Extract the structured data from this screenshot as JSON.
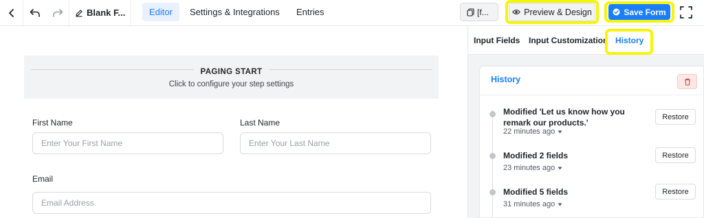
{
  "header": {
    "form_title": "Blank F...",
    "tabs": [
      {
        "label": "Editor",
        "active": true
      },
      {
        "label": "Settings & Integrations",
        "active": false
      },
      {
        "label": "Entries",
        "active": false
      }
    ],
    "shortcode_label": "[f...",
    "preview_label": "Preview & Design",
    "save_label": "Save Form"
  },
  "editor": {
    "paging_title": "PAGING START",
    "paging_subtitle": "Click to configure your step settings",
    "fields": {
      "first_name": {
        "label": "First Name",
        "placeholder": "Enter Your First Name"
      },
      "last_name": {
        "label": "Last Name",
        "placeholder": "Enter Your Last Name"
      },
      "email": {
        "label": "Email",
        "placeholder": "Email Address"
      }
    }
  },
  "panel": {
    "tabs": [
      {
        "label": "Input Fields",
        "active": false
      },
      {
        "label": "Input Customization",
        "active": false
      },
      {
        "label": "History",
        "active": true
      }
    ],
    "history": {
      "title": "History",
      "restore_label": "Restore",
      "items": [
        {
          "message": "Modified 'Let us know how you remark our products.'",
          "time": "22 minutes ago"
        },
        {
          "message": "Modified 2 fields",
          "time": "23 minutes ago"
        },
        {
          "message": "Modified 5 fields",
          "time": "31 minutes ago"
        }
      ]
    }
  },
  "colors": {
    "accent": "#1a7efb",
    "highlight": "#f5f50a",
    "panel_bg": "#f2f3f5"
  },
  "icons": [
    "chevron-left-icon",
    "undo-icon",
    "redo-icon",
    "pencil-icon",
    "copy-icon",
    "eye-icon",
    "check-circle-icon",
    "fullscreen-icon",
    "trash-icon",
    "caret-down-icon"
  ]
}
